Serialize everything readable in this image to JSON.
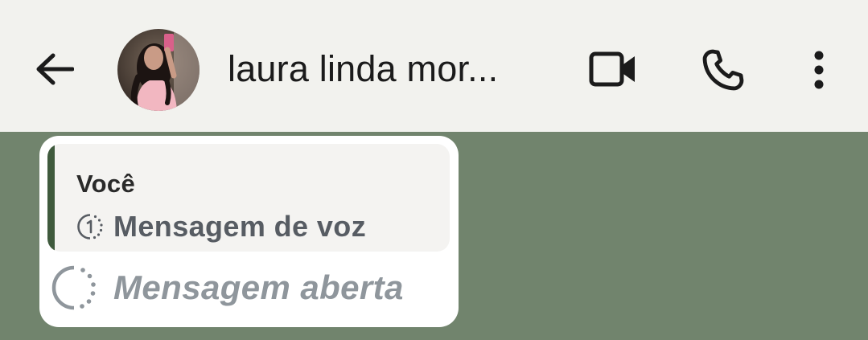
{
  "header": {
    "contact_name": "laura linda mor...",
    "back_icon": "arrow-left-icon",
    "video_icon": "video-camera-icon",
    "call_icon": "phone-icon",
    "menu_icon": "more-vertical-icon",
    "background_color": "#f2f2ee"
  },
  "chat": {
    "background_color": "#71846d",
    "message": {
      "quoted_author": "Você",
      "quoted_icon": "view-once-icon",
      "quoted_text": "Mensagem de voz",
      "opened_icon": "view-once-opened-icon",
      "opened_text": "Mensagem aberta",
      "quote_bar_color": "#3f5a3d"
    }
  }
}
